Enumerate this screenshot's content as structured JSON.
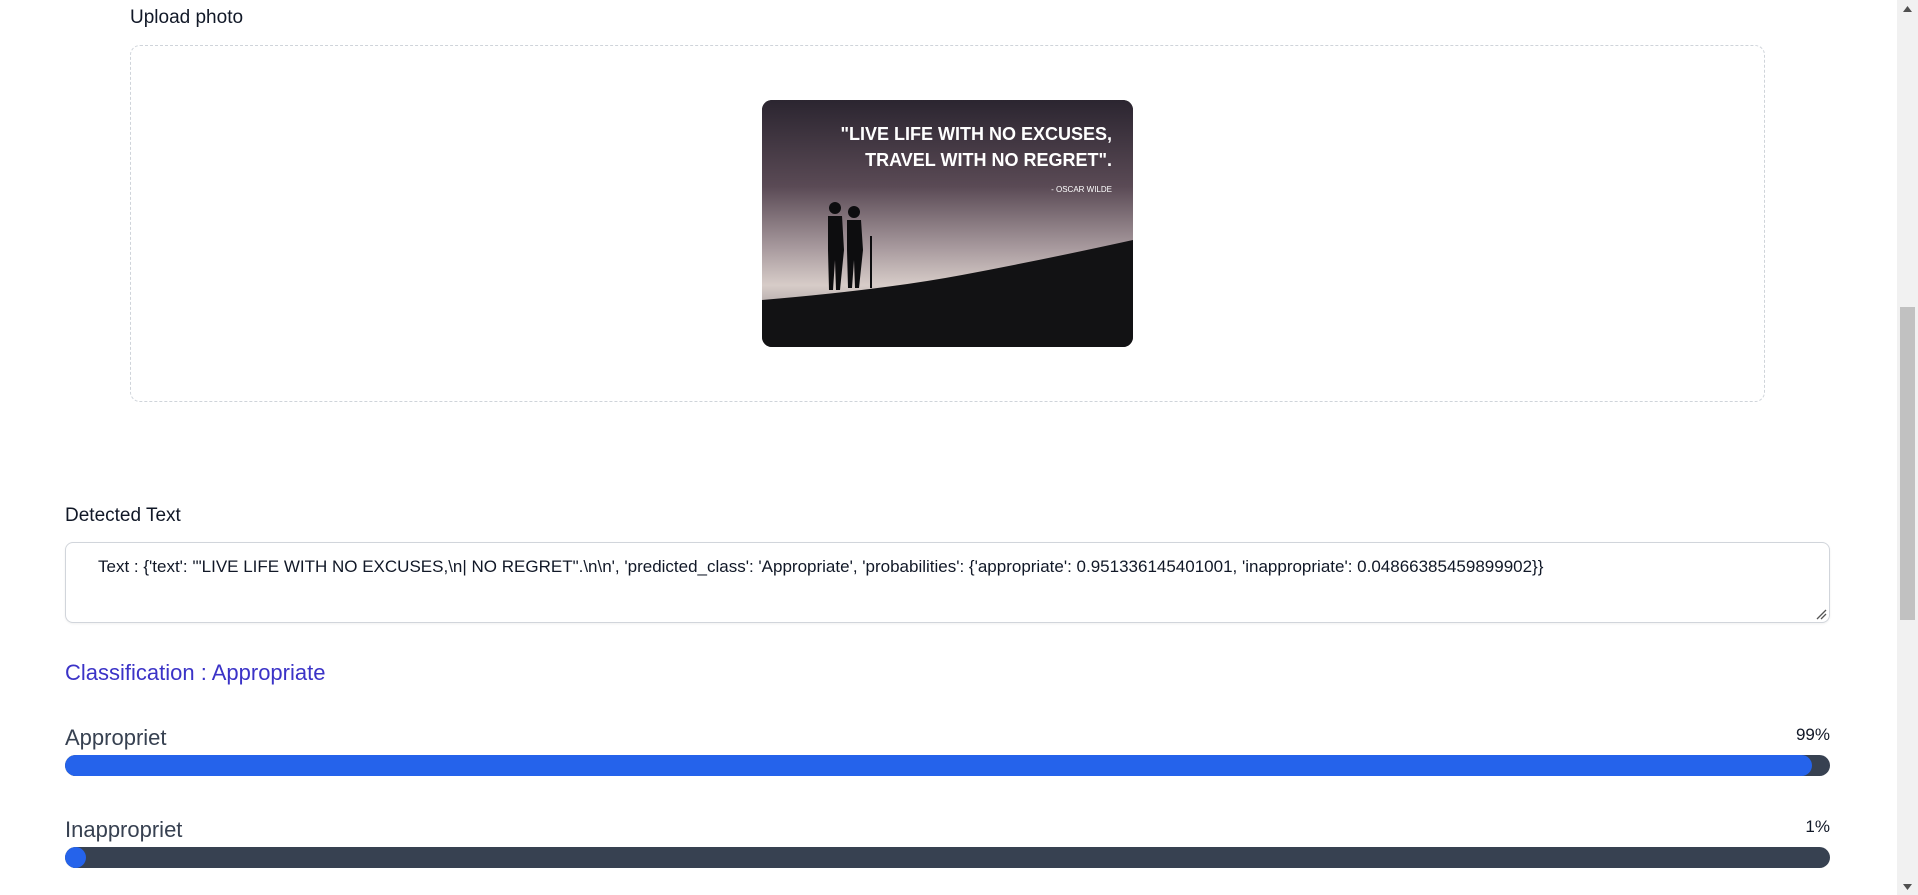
{
  "upload": {
    "label": "Upload photo",
    "preview_image": {
      "quote_line1": "\"LIVE LIFE WITH NO EXCUSES,",
      "quote_line2": "TRAVEL WITH NO REGRET\".",
      "author": "- OSCAR WILDE"
    }
  },
  "detected": {
    "label": "Detected Text",
    "text": "Text : {'text': '\"LIVE LIFE WITH NO EXCUSES,\\n| NO REGRET\".\\n\\n', 'predicted_class': 'Appropriate', 'probabilities': {'appropriate': 0.951336145401001, 'inappropriate': 0.04866385459899902}}"
  },
  "classification": {
    "label": "Classification : Appropriate"
  },
  "bars": [
    {
      "name": "Appropriet",
      "percent_label": "99%",
      "fill_fraction": 0.99
    },
    {
      "name": "Inappropriet",
      "percent_label": "1%",
      "fill_fraction": 0.01
    }
  ],
  "colors": {
    "bar_fill": "#2563eb",
    "bar_track": "#374151",
    "classification_text": "#3b33c7"
  }
}
